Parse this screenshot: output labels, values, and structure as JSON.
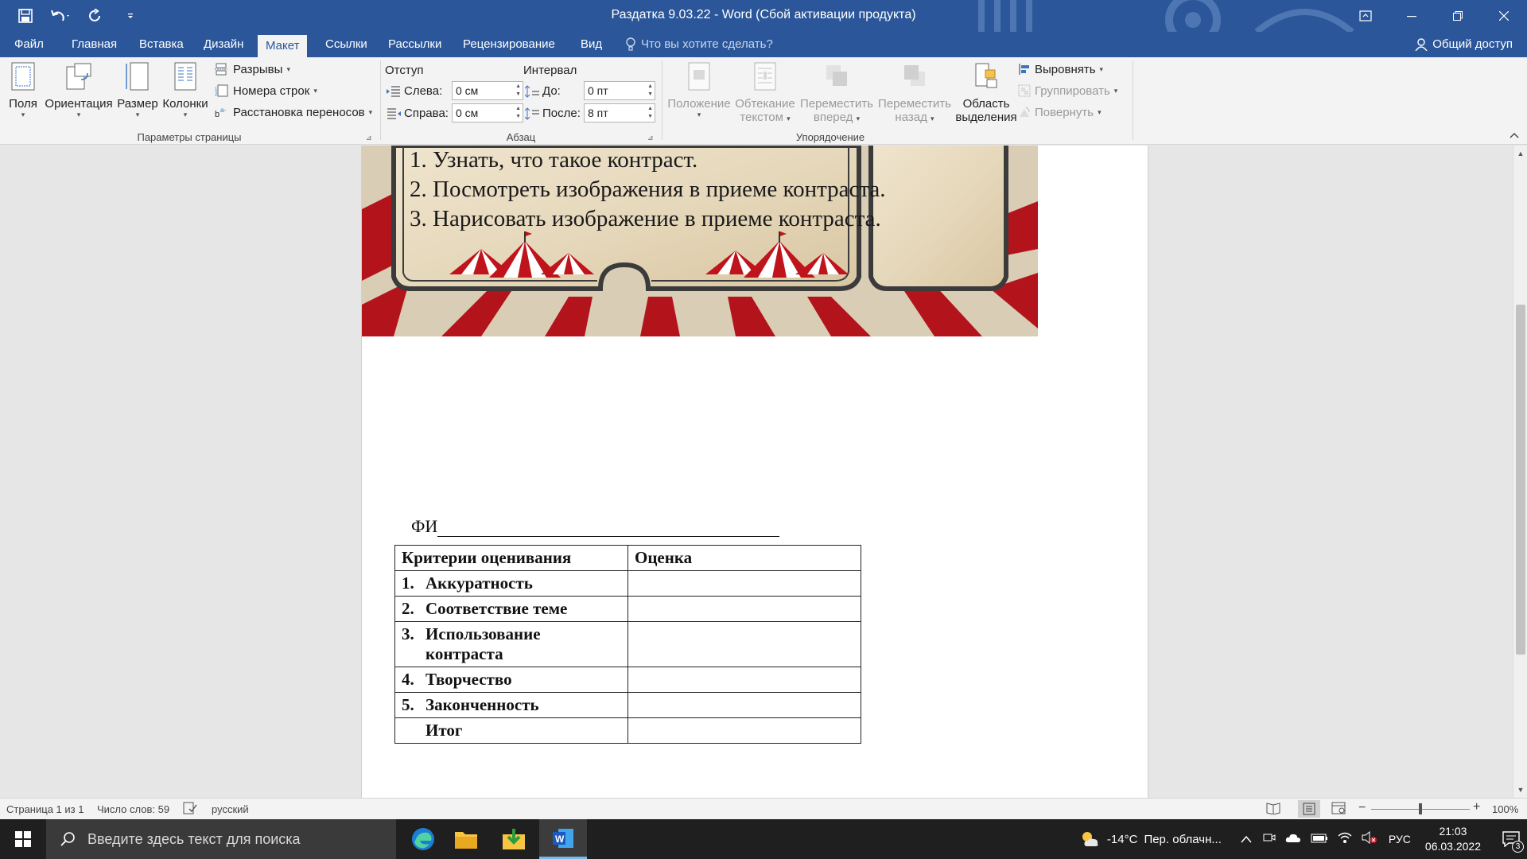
{
  "window": {
    "title": "Раздатка 9.03.22 - Word (Сбой активации продукта)"
  },
  "qat": {
    "save_icon": "save-icon",
    "undo_icon": "undo-icon",
    "redo_icon": "redo-icon"
  },
  "tabs": [
    {
      "label": "Файл"
    },
    {
      "label": "Главная"
    },
    {
      "label": "Вставка"
    },
    {
      "label": "Дизайн"
    },
    {
      "label": "Макет"
    },
    {
      "label": "Ссылки"
    },
    {
      "label": "Рассылки"
    },
    {
      "label": "Рецензирование"
    },
    {
      "label": "Вид"
    }
  ],
  "tell_me": "Что вы хотите сделать?",
  "share": "Общий доступ",
  "ribbon": {
    "page_setup": {
      "label": "Параметры страницы",
      "margins": "Поля",
      "orientation": "Ориентация",
      "size": "Размер",
      "columns": "Колонки",
      "breaks": "Разрывы",
      "line_numbers": "Номера строк",
      "hyphenation": "Расстановка переносов"
    },
    "paragraph": {
      "label": "Абзац",
      "indent_header": "Отступ",
      "spacing_header": "Интервал",
      "left_label": "Слева:",
      "left_value": "0 см",
      "right_label": "Справа:",
      "right_value": "0 см",
      "before_label": "До:",
      "before_value": "0 пт",
      "after_label": "После:",
      "after_value": "8 пт"
    },
    "arrange": {
      "label": "Упорядочение",
      "position_1": "Положение",
      "wrap_1": "Обтекание",
      "wrap_2": "текстом",
      "forward_1": "Переместить",
      "forward_2": "вперед",
      "backward_1": "Переместить",
      "backward_2": "назад",
      "selection_1": "Область",
      "selection_2": "выделения",
      "align": "Выровнять",
      "group": "Группировать",
      "rotate": "Повернуть"
    }
  },
  "document": {
    "list": [
      "1. Узнать, что такое контраст.",
      "2. Посмотреть изображения в приеме контраста.",
      "3. Нарисовать изображение в приеме контраста."
    ],
    "fi_label": "ФИ",
    "table": {
      "header": [
        "Критерии оценивания",
        "Оценка"
      ],
      "rows": [
        {
          "num": "1.",
          "text": "Аккуратность"
        },
        {
          "num": "2.",
          "text": "Соответствие теме"
        },
        {
          "num": "3.",
          "text": "Использование",
          "text2": "контраста"
        },
        {
          "num": "4.",
          "text": "Творчество"
        },
        {
          "num": "5.",
          "text": "Законченность"
        },
        {
          "num": "",
          "text": "Итог"
        }
      ]
    }
  },
  "status": {
    "page": "Страница 1 из 1",
    "words": "Число слов: 59",
    "language": "русский",
    "zoom": "100%",
    "zoom_level": 1.0
  },
  "taskbar": {
    "search_placeholder": "Введите здесь текст для поиска",
    "weather_temp": "-14°C",
    "weather_text": "Пер. облачн...",
    "lang": "РУС",
    "time": "21:03",
    "date": "06.03.2022",
    "notifications": "3"
  },
  "colors": {
    "word_blue": "#2b579a",
    "ribbon_bg": "#f3f3f3",
    "doc_bg": "#e6e6e6",
    "circus_red": "#b3141b",
    "parchment": "#e8dcc3"
  }
}
